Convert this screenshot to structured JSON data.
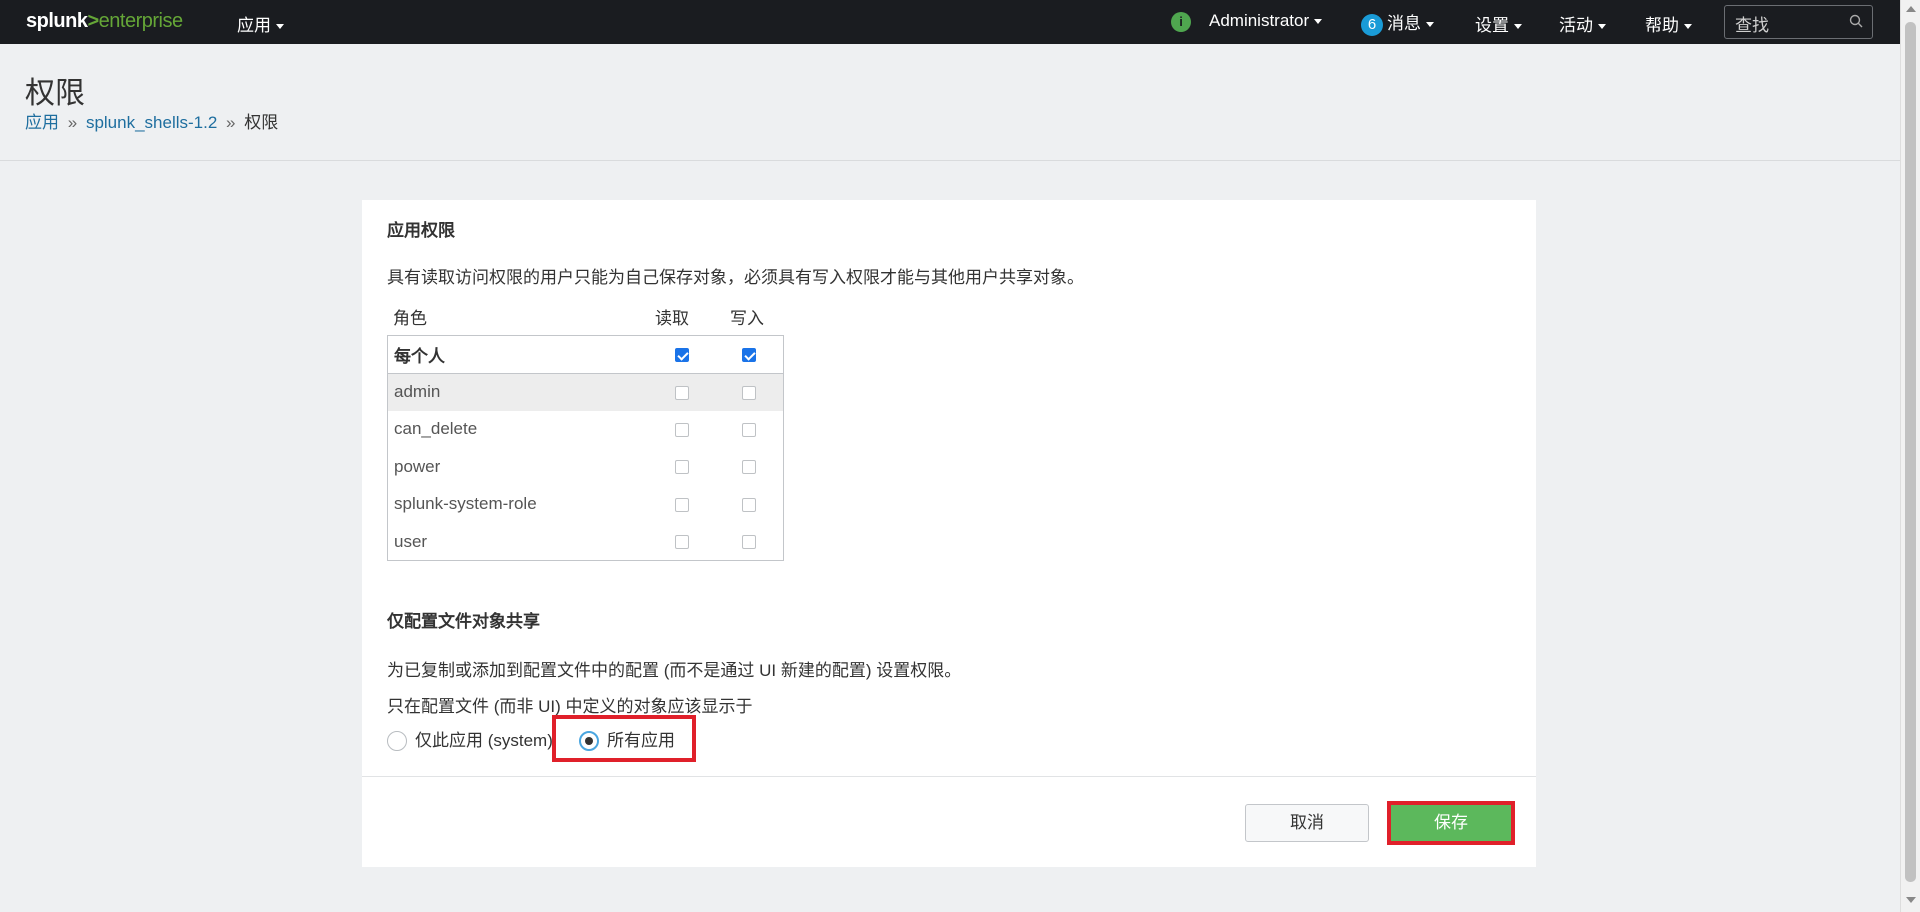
{
  "topbar": {
    "logo_word": "splunk",
    "logo_gt": ">",
    "logo_enterprise": "enterprise",
    "apps_menu": "应用",
    "info_icon": "i",
    "user_menu": "Administrator",
    "messages_count": "6",
    "messages_menu": "消息",
    "settings_menu": "设置",
    "activity_menu": "活动",
    "help_menu": "帮助",
    "search_placeholder": "查找"
  },
  "header": {
    "title": "权限",
    "breadcrumb": {
      "apps_link": "应用",
      "separator": "»",
      "app_link": "splunk_shells-1.2",
      "current": "权限"
    }
  },
  "app_permissions": {
    "title": "应用权限",
    "description": "具有读取访问权限的用户只能为自己保存对象，必须具有写入权限才能与其他用户共享对象。",
    "columns": {
      "role": "角色",
      "read": "读取",
      "write": "写入"
    },
    "everyone_label": "每个人",
    "everyone_read": true,
    "everyone_write": true,
    "roles": [
      "admin",
      "can_delete",
      "power",
      "splunk-system-role",
      "user"
    ]
  },
  "config_sharing": {
    "title": "仅配置文件对象共享",
    "description": "为已复制或添加到配置文件中的配置 (而不是通过 UI 新建的配置) 设置权限。",
    "prompt": "只在配置文件 (而非 UI) 中定义的对象应该显示于",
    "option_this_app": "仅此应用 (system)",
    "option_all_apps": "所有应用",
    "selected": "all_apps"
  },
  "actions": {
    "cancel_label": "取消",
    "save_label": "保存"
  },
  "colors": {
    "navbar_bg": "#1a1c20",
    "splunk_green": "#65a637",
    "link_blue": "#1e6e9f",
    "save_green": "#5cb85c",
    "highlight_red": "#e0202a",
    "checkbox_blue": "#1a73e8"
  }
}
